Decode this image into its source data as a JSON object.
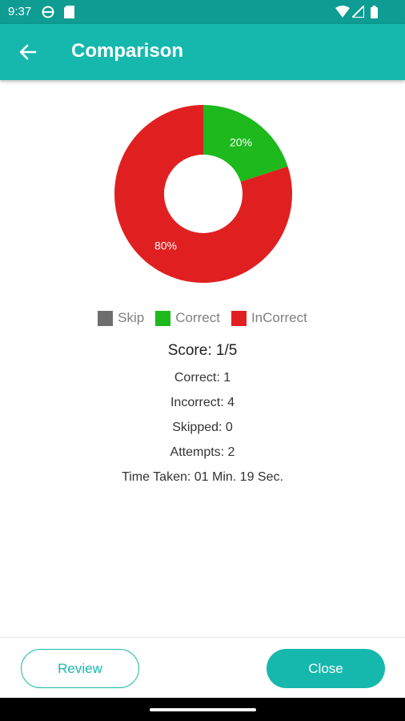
{
  "status_bar": {
    "time": "9:37",
    "icons": [
      "vpn-icon",
      "sim-card-icon",
      "wifi-icon",
      "signal-icon",
      "battery-icon"
    ]
  },
  "app_bar": {
    "back_icon": "arrow-left-icon",
    "title": "Comparison"
  },
  "chart_data": {
    "type": "pie",
    "donut": true,
    "slices": [
      {
        "name": "Correct",
        "value": 20,
        "label": "20%",
        "color": "#1db91d"
      },
      {
        "name": "InCorrect",
        "value": 80,
        "label": "80%",
        "color": "#e02020"
      }
    ],
    "legend": [
      {
        "name": "Skip",
        "color": "#6e6e6e"
      },
      {
        "name": "Correct",
        "color": "#1db91d"
      },
      {
        "name": "InCorrect",
        "color": "#e02020"
      }
    ],
    "legend_position": "bottom"
  },
  "stats": {
    "score": "Score: 1/5",
    "correct": "Correct: 1",
    "incorrect": "Incorrect: 4",
    "skipped": "Skipped: 0",
    "attempts": "Attempts: 2",
    "time_taken": "Time Taken: 01 Min. 19 Sec."
  },
  "buttons": {
    "review": "Review",
    "close": "Close"
  },
  "colors": {
    "primary": "#16b8ad",
    "status_bar": "#0e9c93"
  }
}
